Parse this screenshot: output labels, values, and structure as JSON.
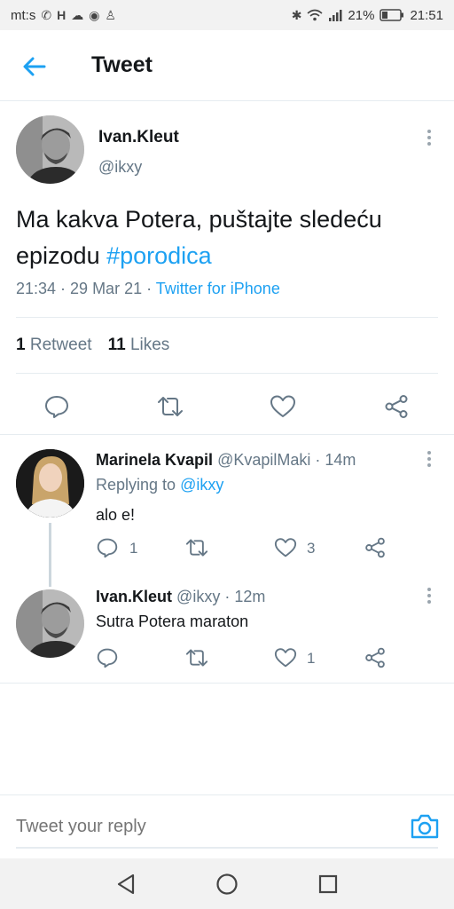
{
  "status_bar": {
    "left_text": "mt:s",
    "battery": "21%",
    "time": "21:51"
  },
  "header": {
    "title": "Tweet"
  },
  "main_tweet": {
    "name": "Ivan.Kleut",
    "handle": "@ikxy",
    "text": "Ma kakva Potera, puštajte sledeću epizodu ",
    "hashtag": "#porodica",
    "time_date": "21:34 · 29 Mar 21 · ",
    "source": "Twitter for iPhone",
    "retweet_count": "1",
    "retweet_label": "Retweet",
    "likes_count": "11",
    "likes_label": "Likes"
  },
  "replies": [
    {
      "name": "Marinela Kvapil",
      "meta": "@KvapilMaki · 14m",
      "replying_label": "Replying to ",
      "replying_handle": "@ikxy",
      "text": "alo e!",
      "reply_count": "1",
      "like_count": "3"
    },
    {
      "name": "Ivan.Kleut",
      "meta": "@ikxy · 12m",
      "text": "Sutra Potera maraton",
      "like_count": "1"
    }
  ],
  "compose": {
    "placeholder": "Tweet your reply"
  },
  "colors": {
    "accent": "#1da1f2",
    "text_secondary": "#657786",
    "icon_gray": "#657786"
  }
}
